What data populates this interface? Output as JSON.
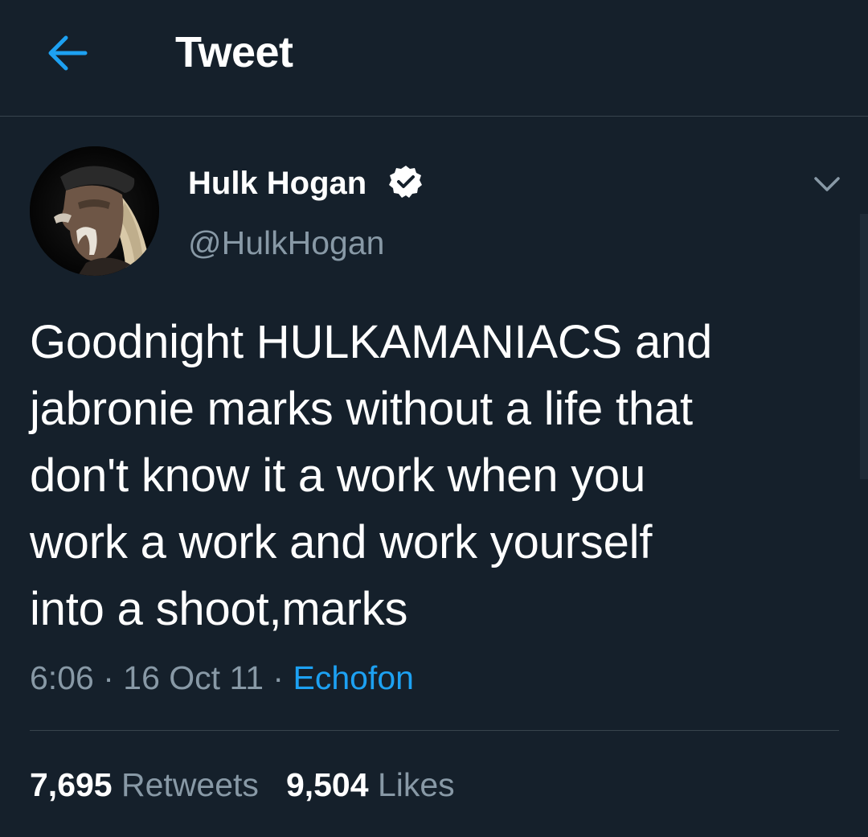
{
  "header": {
    "back_icon": "arrow-left-icon",
    "title": "Tweet"
  },
  "author": {
    "name": "Hulk Hogan",
    "handle": "@HulkHogan",
    "verified": true,
    "verified_icon": "verified-badge-icon",
    "menu_icon": "chevron-down-icon"
  },
  "tweet": {
    "text_lines": [
      "Goodnight HULKAMANIACS and",
      "jabronie marks without a life that",
      "don't know it a work when you",
      "work a work and work yourself",
      "into a shoot,marks"
    ],
    "time": "6:06",
    "date": "16 Oct 11",
    "separator": "·",
    "source": "Echofon"
  },
  "stats": {
    "retweets_count": "7,695",
    "retweets_label": "Retweets",
    "likes_count": "9,504",
    "likes_label": "Likes"
  },
  "colors": {
    "background": "#15202b",
    "accent": "#1da1f2",
    "secondary_text": "#8899a6",
    "divider": "#38444d"
  }
}
